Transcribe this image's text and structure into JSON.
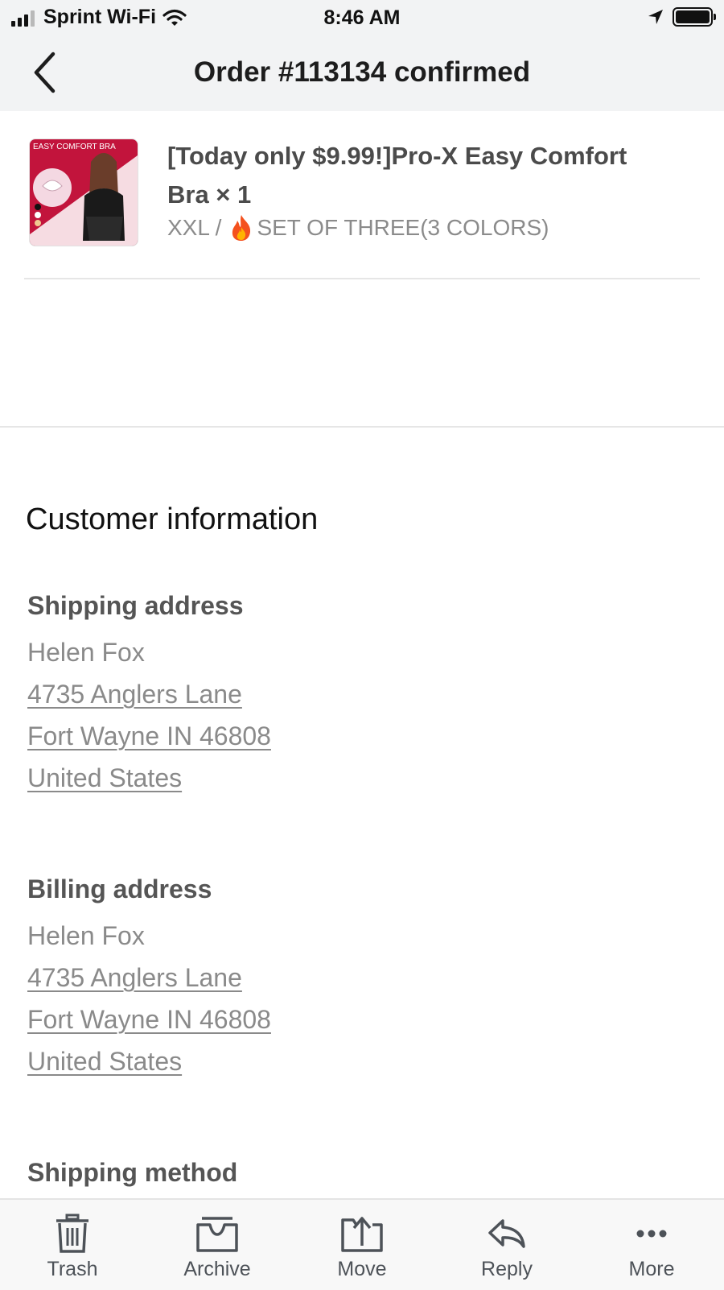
{
  "status_bar": {
    "carrier": "Sprint Wi-Fi",
    "time": "8:46 AM",
    "signal_bars_filled": 3,
    "signal_bars_total": 4
  },
  "navbar": {
    "title": "Order #113134 confirmed",
    "back_icon": "chevron-left-icon"
  },
  "product": {
    "image_caption": "EASY COMFORT BRA",
    "title": "[Today only $9.99!]Pro-X Easy Comfort Bra × 1",
    "variant_size": "XXL /",
    "variant_icon": "fire-icon",
    "variant_option": "SET OF THREE(3 COLORS)"
  },
  "customer": {
    "section_title": "Customer information",
    "shipping": {
      "heading": "Shipping address",
      "name": "Helen Fox",
      "street": "4735 Anglers Lane",
      "city": "Fort Wayne IN 46808",
      "country": "United States"
    },
    "billing": {
      "heading": "Billing address",
      "name": "Helen Fox",
      "street": "4735 Anglers Lane",
      "city": "Fort Wayne IN 46808",
      "country": "United States"
    },
    "shipping_method_heading": "Shipping method"
  },
  "toolbar": {
    "items": [
      {
        "label": "Trash",
        "icon": "trash-icon"
      },
      {
        "label": "Archive",
        "icon": "archive-icon"
      },
      {
        "label": "Move",
        "icon": "move-icon"
      },
      {
        "label": "Reply",
        "icon": "reply-icon"
      },
      {
        "label": "More",
        "icon": "more-icon"
      }
    ]
  },
  "colors": {
    "bar_background": "#f2f3f4",
    "product_image_bg": "#c2143c",
    "text_secondary": "#8a8a8a",
    "toolbar_text": "#4d5258"
  }
}
